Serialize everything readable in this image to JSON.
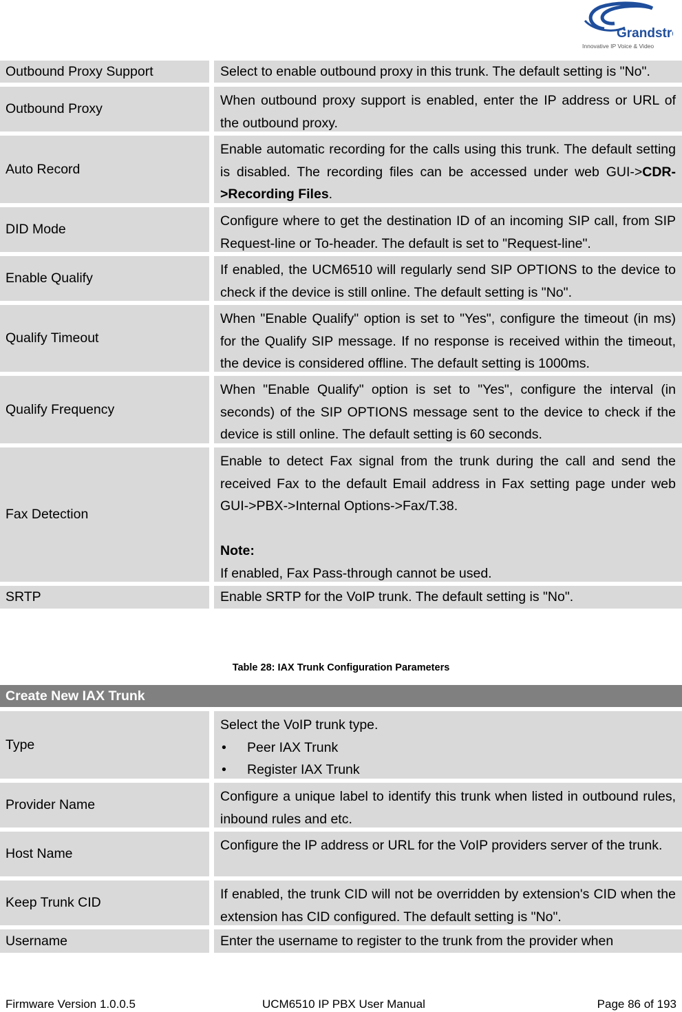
{
  "logo": {
    "brand": "Grandstream",
    "tagline": "Innovative IP Voice & Video",
    "color": "#1f4e9c"
  },
  "sip_table": {
    "rows": [
      {
        "name": "Outbound Proxy Support",
        "desc": "Select to enable outbound proxy in this trunk. The default setting is \"No\"."
      },
      {
        "name": "Outbound Proxy",
        "desc": "When outbound proxy support is enabled, enter the IP address or URL of the outbound proxy."
      },
      {
        "name": "Auto Record",
        "desc_prefix": "Enable automatic recording for the calls using this trunk. The default setting is disabled. The recording files can be accessed under web GUI->",
        "desc_bold1": "CDR",
        "desc_sep": "->",
        "desc_bold2": "Recording Files",
        "desc_suffix": "."
      },
      {
        "name": "DID Mode",
        "desc": "Configure where to get the destination ID of an incoming SIP call, from SIP Request-line or To-header. The default is set to \"Request-line\"."
      },
      {
        "name": "Enable Qualify",
        "desc": "If enabled, the UCM6510 will regularly send SIP OPTIONS to the device to check if the device is still online. The default setting is \"No\"."
      },
      {
        "name": "Qualify Timeout",
        "desc": "When \"Enable Qualify\" option is set to \"Yes\", configure the timeout (in ms) for the Qualify SIP message. If no response is received within the timeout, the device is considered offline. The default setting is 1000ms."
      },
      {
        "name": "Qualify Frequency",
        "desc": "When \"Enable Qualify\" option is set to \"Yes\", configure the interval (in seconds) of the SIP OPTIONS message sent to the device to check if the device is still online. The default setting is 60 seconds."
      },
      {
        "name": "Fax Detection",
        "desc": "Enable to detect Fax signal from the trunk during the call and send the received Fax to the default Email address in Fax setting page under web GUI->PBX->Internal Options->Fax/T.38.",
        "note_label": "Note:",
        "note_text": "If enabled, Fax Pass-through cannot be used."
      },
      {
        "name": "SRTP",
        "desc": "Enable SRTP for the VoIP trunk. The default setting is \"No\"."
      }
    ]
  },
  "iax_table": {
    "caption": "Table 28: IAX Trunk Configuration Parameters",
    "header": "Create New IAX Trunk",
    "rows": [
      {
        "name": "Type",
        "desc": "Select the VoIP trunk type.",
        "bullets": [
          "Peer IAX Trunk",
          "Register IAX Trunk"
        ]
      },
      {
        "name": "Provider Name",
        "desc": "Configure a unique label to identify this trunk when listed in outbound rules, inbound rules and etc."
      },
      {
        "name": "Host Name",
        "desc": "Configure the IP address or URL for the VoIP providers server of the trunk."
      },
      {
        "name": "Keep Trunk CID",
        "desc": "If enabled, the trunk CID will not be overridden by extension's CID when the extension has CID configured. The default setting is \"No\"."
      },
      {
        "name": "Username",
        "desc": "Enter the username to register to the trunk from the provider when"
      }
    ]
  },
  "footer": {
    "firmware": "Firmware Version 1.0.0.5",
    "manual": "UCM6510 IP PBX User Manual",
    "page": "Page 86 of 193"
  }
}
